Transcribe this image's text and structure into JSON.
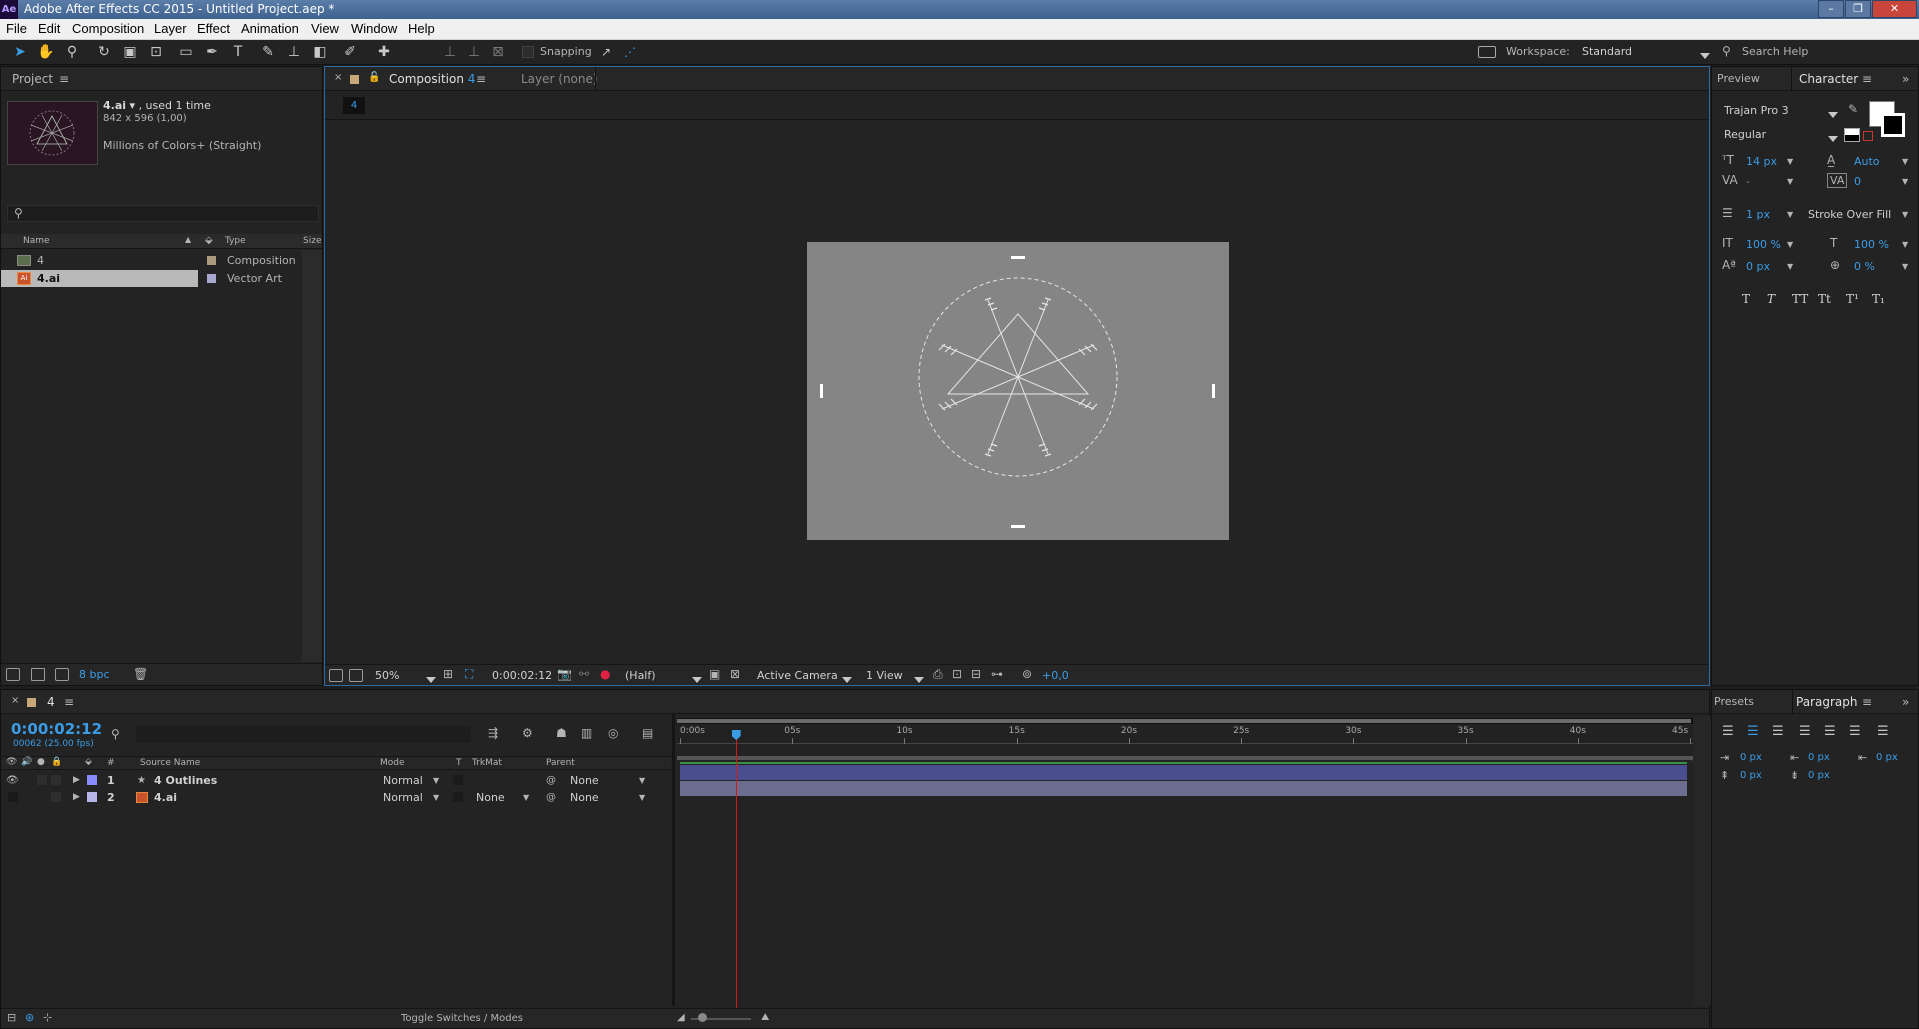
{
  "window": {
    "title": "Adobe After Effects CC 2015 - Untitled Project.aep *",
    "logo": "Ae"
  },
  "menu": [
    "File",
    "Edit",
    "Composition",
    "Layer",
    "Effect",
    "Animation",
    "View",
    "Window",
    "Help"
  ],
  "toolbar": {
    "snapping_label": "Snapping",
    "workspace_label": "Workspace:",
    "workspace_value": "Standard",
    "search_help": "Search Help"
  },
  "project": {
    "tab": "Project",
    "selected_item": {
      "name": "4.ai",
      "used": ", used 1 time",
      "dims": "842 x 596 (1,00)",
      "colors": "Millions of Colors+ (Straight)"
    },
    "columns": {
      "name": "Name",
      "type": "Type",
      "size": "Size"
    },
    "items": [
      {
        "name": "4",
        "type": "Composition"
      },
      {
        "name": "4.ai",
        "type": "Vector Art"
      }
    ],
    "footer_bpc": "8 bpc"
  },
  "composition": {
    "tab": "Composition",
    "tab_num": "4",
    "layer_tab": "Layer (none)",
    "breadcrumb": "4",
    "zoom": "50%",
    "timecode": "0:00:02:12",
    "resolution": "(Half)",
    "camera": "Active Camera",
    "view": "1 View",
    "exposure": "+0,0"
  },
  "preview_tab": "Preview",
  "character": {
    "tab": "Character",
    "font": "Trajan Pro 3",
    "style": "Regular",
    "size": "14 px",
    "leading": "Auto",
    "kerning": "-",
    "tracking": "0",
    "stroke_width": "1 px",
    "stroke_mode": "Stroke Over Fill",
    "vscale": "100 %",
    "hscale": "100 %",
    "baseline": "0 px",
    "tsume": "0 %",
    "style_buttons": [
      "T",
      "T",
      "TT",
      "Tt",
      "T¹",
      "T₁"
    ]
  },
  "timeline": {
    "tab_num": "4",
    "timecode": "0:00:02:12",
    "frames": "00062 (25.00 fps)",
    "columns": {
      "num": "#",
      "source": "Source Name",
      "mode": "Mode",
      "t": "T",
      "trkmat": "TrkMat",
      "parent": "Parent"
    },
    "layers": [
      {
        "num": "1",
        "name": "4 Outlines",
        "mode": "Normal",
        "trkmat": "",
        "parent": "None",
        "color": "#8a8aff"
      },
      {
        "num": "2",
        "name": "4.ai",
        "mode": "Normal",
        "trkmat": "None",
        "parent": "None",
        "color": "#b4b4e6"
      }
    ],
    "ruler": [
      "0:00s",
      "05s",
      "10s",
      "15s",
      "20s",
      "25s",
      "30s",
      "35s",
      "40s",
      "45s"
    ],
    "footer_label": "Toggle Switches / Modes",
    "playhead_seconds": 2.48,
    "duration_seconds": 45
  },
  "presets_tab": "Presets",
  "paragraph": {
    "tab": "Paragraph",
    "indent_left": "0 px",
    "indent_first": "0 px",
    "indent_right": "0 px",
    "space_before": "0 px",
    "space_after": "0 px"
  },
  "colors": {
    "accent": "#3b9ce6",
    "bar_layer1": "#4a4e8e",
    "bar_layer2": "#6d6d8f",
    "playhead": "#d21c1c",
    "work_area": "#3a8f4a"
  }
}
